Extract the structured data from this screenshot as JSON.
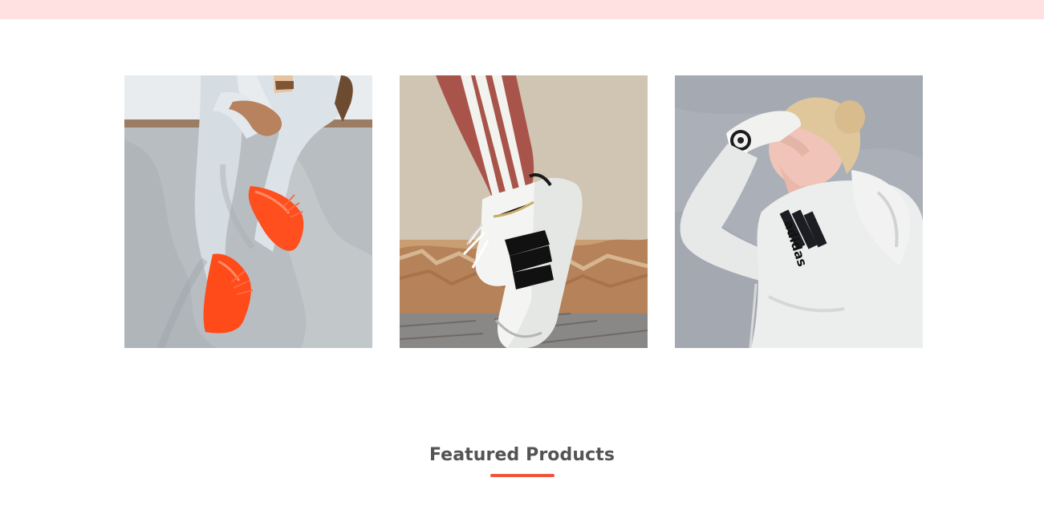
{
  "theme": {
    "top_band_color": "#ffe1e2",
    "accent": "#ef553d",
    "heading_color": "#545454"
  },
  "gallery": {
    "items": [
      {
        "name": "person-with-orange-sneakers-photo",
        "subject": "orange-sneakers"
      },
      {
        "name": "superstar-sneaker-photo",
        "subject": "white-black-striped-sneaker"
      },
      {
        "name": "woman-in-white-hoodie-photo",
        "subject": "white-hoodie"
      }
    ]
  },
  "featured": {
    "title": "Featured Products"
  }
}
